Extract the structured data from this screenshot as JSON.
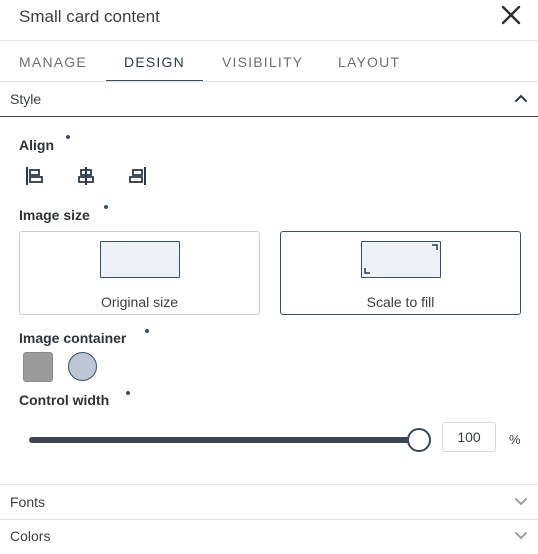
{
  "header": {
    "title": "Small card content"
  },
  "tabs": [
    {
      "label": "MANAGE",
      "active": false
    },
    {
      "label": "DESIGN",
      "active": true
    },
    {
      "label": "VISIBILITY",
      "active": false
    },
    {
      "label": "LAYOUT",
      "active": false
    }
  ],
  "sections": {
    "style": {
      "label": "Style",
      "expanded": true
    },
    "fonts": {
      "label": "Fonts",
      "expanded": false
    },
    "colors": {
      "label": "Colors",
      "expanded": false
    }
  },
  "style": {
    "align": {
      "label": "Align",
      "options": [
        {
          "icon": "align-left-icon"
        },
        {
          "icon": "align-center-icon"
        },
        {
          "icon": "align-right-icon"
        }
      ]
    },
    "image_size": {
      "label": "Image size",
      "options": [
        {
          "caption": "Original size",
          "selected": false
        },
        {
          "caption": "Scale to fill",
          "selected": true
        }
      ]
    },
    "image_container": {
      "label": "Image container",
      "options": [
        {
          "shape": "square",
          "color": "#9b9b9b"
        },
        {
          "shape": "circle",
          "color": "#bcc6d5"
        }
      ]
    },
    "control_width": {
      "label": "Control width",
      "value": "100",
      "unit": "%",
      "fraction": 1.0
    }
  },
  "colors": {
    "accent": "#36506a",
    "track": "#3a4654"
  }
}
